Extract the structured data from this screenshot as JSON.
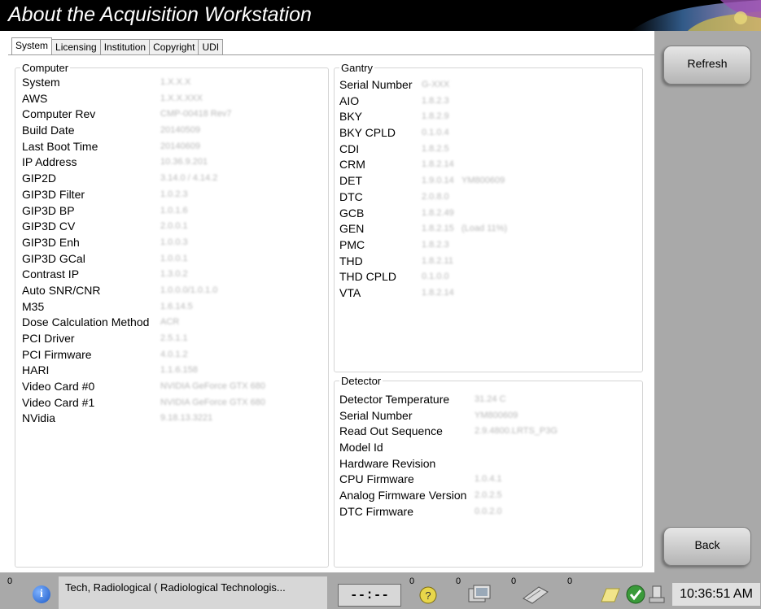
{
  "window": {
    "title": "About the Acquisition Workstation"
  },
  "tabs": [
    {
      "label": "System",
      "active": true
    },
    {
      "label": "Licensing",
      "active": false
    },
    {
      "label": "Institution",
      "active": false
    },
    {
      "label": "Copyright",
      "active": false
    },
    {
      "label": "UDI",
      "active": false
    }
  ],
  "computer": {
    "legend": "Computer",
    "rows": [
      {
        "label": "System",
        "value": "1.X.X.X"
      },
      {
        "label": "AWS",
        "value": "1.X.X.XXX"
      },
      {
        "label": "Computer Rev",
        "value": "CMP-00418 Rev7"
      },
      {
        "label": "Build Date",
        "value": "20140509"
      },
      {
        "label": "Last Boot Time",
        "value": "20140609"
      },
      {
        "label": "IP Address",
        "value": "10.36.9.201"
      },
      {
        "label": "GIP2D",
        "value": "3.14.0 / 4.14.2"
      },
      {
        "label": "GIP3D Filter",
        "value": "1.0.2.3"
      },
      {
        "label": "GIP3D BP",
        "value": "1.0.1.6"
      },
      {
        "label": "GIP3D CV",
        "value": "2.0.0.1"
      },
      {
        "label": "GIP3D Enh",
        "value": "1.0.0.3"
      },
      {
        "label": "GIP3D GCal",
        "value": "1.0.0.1"
      },
      {
        "label": "Contrast IP",
        "value": "1.3.0.2"
      },
      {
        "label": "Auto SNR/CNR",
        "value": "1.0.0.0/1.0.1.0"
      },
      {
        "label": "M35",
        "value": "1.6.14.5"
      },
      {
        "label": "Dose Calculation Method",
        "value": "ACR"
      },
      {
        "label": "PCI Driver",
        "value": "2.5.1.1"
      },
      {
        "label": "PCI Firmware",
        "value": "4.0.1.2"
      },
      {
        "label": "HARI",
        "value": "1.1.6.158"
      },
      {
        "label": "Video Card #0",
        "value": "NVIDIA GeForce GTX 680"
      },
      {
        "label": "Video Card #1",
        "value": "NVIDIA GeForce GTX 680"
      },
      {
        "label": "NVidia",
        "value": "9.18.13.3221"
      }
    ]
  },
  "gantry": {
    "legend": "Gantry",
    "rows": [
      {
        "label": "Serial Number",
        "value": "G-XXX",
        "extra": ""
      },
      {
        "label": "AIO",
        "value": "1.8.2.3",
        "extra": ""
      },
      {
        "label": "BKY",
        "value": "1.8.2.9",
        "extra": ""
      },
      {
        "label": "BKY CPLD",
        "value": "0.1.0.4",
        "extra": ""
      },
      {
        "label": "CDI",
        "value": "1.8.2.5",
        "extra": ""
      },
      {
        "label": "CRM",
        "value": "1.8.2.14",
        "extra": ""
      },
      {
        "label": "DET",
        "value": "1.9.0.14",
        "extra": "YM800609"
      },
      {
        "label": "DTC",
        "value": "2.0.8.0",
        "extra": ""
      },
      {
        "label": "GCB",
        "value": "1.8.2.49",
        "extra": ""
      },
      {
        "label": "GEN",
        "value": "1.8.2.15",
        "extra": "(Load 11%)"
      },
      {
        "label": "PMC",
        "value": "1.8.2.3",
        "extra": ""
      },
      {
        "label": "THD",
        "value": "1.8.2.11",
        "extra": ""
      },
      {
        "label": "THD CPLD",
        "value": "0.1.0.0",
        "extra": ""
      },
      {
        "label": "VTA",
        "value": "1.8.2.14",
        "extra": ""
      }
    ]
  },
  "detector": {
    "legend": "Detector",
    "rows": [
      {
        "label": "Detector Temperature",
        "value": "31.24 C"
      },
      {
        "label": "Serial Number",
        "value": "YM800609"
      },
      {
        "label": "Read Out Sequence",
        "value": "2.9.4800.LRTS_P3G"
      },
      {
        "label": "Model Id",
        "value": ""
      },
      {
        "label": "Hardware Revision",
        "value": ""
      },
      {
        "label": "CPU Firmware",
        "value": "1.0.4.1"
      },
      {
        "label": "Analog Firmware Version",
        "value": "2.0.2.5"
      },
      {
        "label": "DTC Firmware",
        "value": "0.0.2.0"
      }
    ]
  },
  "buttons": {
    "refresh": "Refresh",
    "back": "Back"
  },
  "statusbar": {
    "alerts_count": "0",
    "user": "Tech, Radiological ( Radiological Technologis...",
    "timer": "--:--",
    "help_count": "0",
    "queue_count": "0",
    "print_count": "0",
    "tasks_count": "0",
    "clock": "10:36:51 AM"
  }
}
